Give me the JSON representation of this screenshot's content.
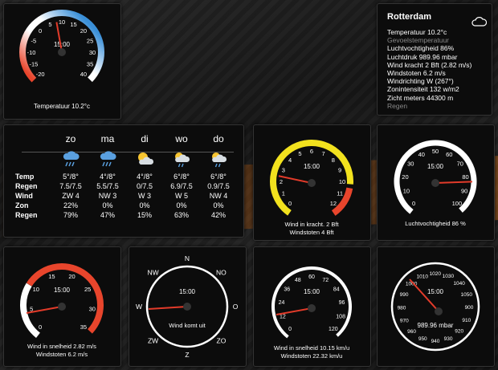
{
  "gauges": {
    "temperature": {
      "center": "15:00",
      "caption1": "Temperatuur 10.2°c",
      "caption2": "",
      "ticks": [
        "-20",
        "-15",
        "-10",
        "-5",
        "0",
        "5",
        "10",
        "15",
        "20",
        "25",
        "30",
        "35",
        "40"
      ],
      "value": 10.2
    },
    "wind_bft": {
      "center": "15:00",
      "caption1": "Wind in kracht. 2 Bft",
      "caption2": "Windstoten 4 Bft",
      "ticks": [
        "0",
        "1",
        "2",
        "3",
        "4",
        "5",
        "6",
        "7",
        "8",
        "9",
        "10",
        "11",
        "12"
      ],
      "value": 2
    },
    "humidity": {
      "center": "15:00",
      "caption1": "Luchtvochtigheid 86 %",
      "caption2": "",
      "ticks": [
        "0",
        "10",
        "20",
        "30",
        "40",
        "50",
        "60",
        "70",
        "80",
        "90",
        "100"
      ],
      "value": 86
    },
    "wind_ms": {
      "center": "15:00",
      "caption1": "Wind in snelheid 2.82 m/s",
      "caption2": "Windstoten 6.2 m/s",
      "ticks": [
        "0",
        "5",
        "10",
        "15",
        "20",
        "25",
        "30",
        "35"
      ],
      "value": 2.82
    },
    "wind_dir": {
      "center": "15:00",
      "caption1": "Wind komt uit",
      "caption2": "",
      "labels": [
        "N",
        "NO",
        "O",
        "ZO",
        "Z",
        "ZW",
        "W",
        "NW"
      ],
      "value": 267
    },
    "wind_kmh": {
      "center": "15:00",
      "caption1": "Wind in snelheid 10.15 km/u",
      "caption2": "Windstoten 22.32 km/u",
      "ticks": [
        "0",
        "12",
        "24",
        "36",
        "48",
        "60",
        "72",
        "84",
        "96",
        "108",
        "120"
      ],
      "value": 10.15
    },
    "pressure": {
      "center": "15:00",
      "caption1": "989.96 mbar",
      "caption2": "",
      "ticks": [
        "950",
        "960",
        "970",
        "980",
        "990",
        "1000",
        "1010",
        "1020",
        "1030",
        "1040",
        "1050",
        "900",
        "910",
        "920",
        "930",
        "940"
      ],
      "value": 989.96
    }
  },
  "info": {
    "city": "Rotterdam",
    "lines": [
      "Temperatuur 10.2°c",
      "Gevoelstemperatuur",
      "Luchtvochtigheid 86%",
      "Luchtdruk 989.96 mbar",
      "Wind kracht 2 Bft (2.82 m/s)",
      "Windstoten 6.2 m/s",
      "Windrichting W (267°)",
      "Zonintensiteit 132 w/m2",
      "Zicht meters 44300 m",
      "Regen"
    ],
    "dim_lines": [
      1,
      9
    ],
    "icon": "cloud-icon"
  },
  "forecast": {
    "days": [
      "zo",
      "ma",
      "di",
      "wo",
      "do"
    ],
    "icons": [
      "rain-icon",
      "rain-icon",
      "sun-cloud-icon",
      "sun-cloud-rain-icon",
      "sun-cloud-rain-icon"
    ],
    "rows": [
      {
        "label": "Temp",
        "values": [
          "5°/8°",
          "4°/8°",
          "4°/8°",
          "6°/8°",
          "6°/8°"
        ]
      },
      {
        "label": "Regen",
        "values": [
          "7.5/7.5",
          "5.5/7.5",
          "0/7.5",
          "6.9/7.5",
          "0.9/7.5"
        ]
      },
      {
        "label": "Wind",
        "values": [
          "ZW 4",
          "NW 3",
          "W 3",
          "W 5",
          "NW 4"
        ]
      },
      {
        "label": "Zon",
        "values": [
          "22%",
          "0%",
          "0%",
          "0%",
          "0%"
        ]
      },
      {
        "label": "Regen",
        "values": [
          "79%",
          "47%",
          "15%",
          "63%",
          "42%"
        ]
      }
    ]
  },
  "colors": {
    "accent_red": "#e8452c",
    "accent_yellow": "#f2e21e",
    "needle": "#e23b2a",
    "accent_blue": "#3a8fd8"
  }
}
